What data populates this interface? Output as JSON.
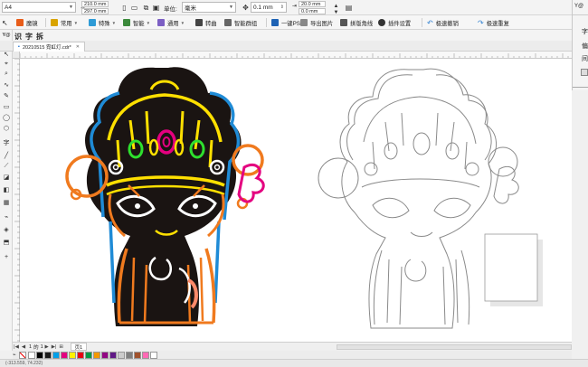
{
  "propbar": {
    "page_size": "A4",
    "width": "210.0 mm",
    "height": "297.0 mm",
    "units_label": "单位:",
    "units_value": "毫米",
    "nudge": "0.1 mm",
    "dup_x": "20.0 mm",
    "dup_y": "0.0 mm"
  },
  "quickbar": {
    "yq_label": "Y@",
    "glyph_1": "识",
    "glyph_2": "字",
    "glyph_3": "拆"
  },
  "plugbar": {
    "items": [
      {
        "label": "魔镜"
      },
      {
        "label": "常用"
      },
      {
        "label": "特殊"
      },
      {
        "label": "智能"
      },
      {
        "label": "通用"
      },
      {
        "label": "转曲"
      },
      {
        "label": "智能群组"
      },
      {
        "label": "一键PS"
      },
      {
        "label": "导出图片"
      },
      {
        "label": "拼版角线"
      },
      {
        "label": "插件设置"
      },
      {
        "label": "极速撤销"
      },
      {
        "label": "极速重复"
      }
    ]
  },
  "docker": {
    "yq": "Y@",
    "l1": "字",
    "l2": "偏",
    "l3": "间"
  },
  "document": {
    "tab_title": "20210515 霓虹灯.cdr*"
  },
  "pages": {
    "current": "1",
    "of": "的",
    "total": "1",
    "tab": "页1"
  },
  "status": {
    "coords": "(-313.559, 74.232)"
  },
  "palette": {
    "colors": [
      "#ffffff",
      "#000000",
      "#1a1a1a",
      "#00a0e9",
      "#e4007f",
      "#fff100",
      "#e60012",
      "#009944",
      "#f39800",
      "#920783",
      "#601986",
      "#cccccc",
      "#808080",
      "#a0522d",
      "#ff69b4",
      "#ffffff"
    ]
  }
}
